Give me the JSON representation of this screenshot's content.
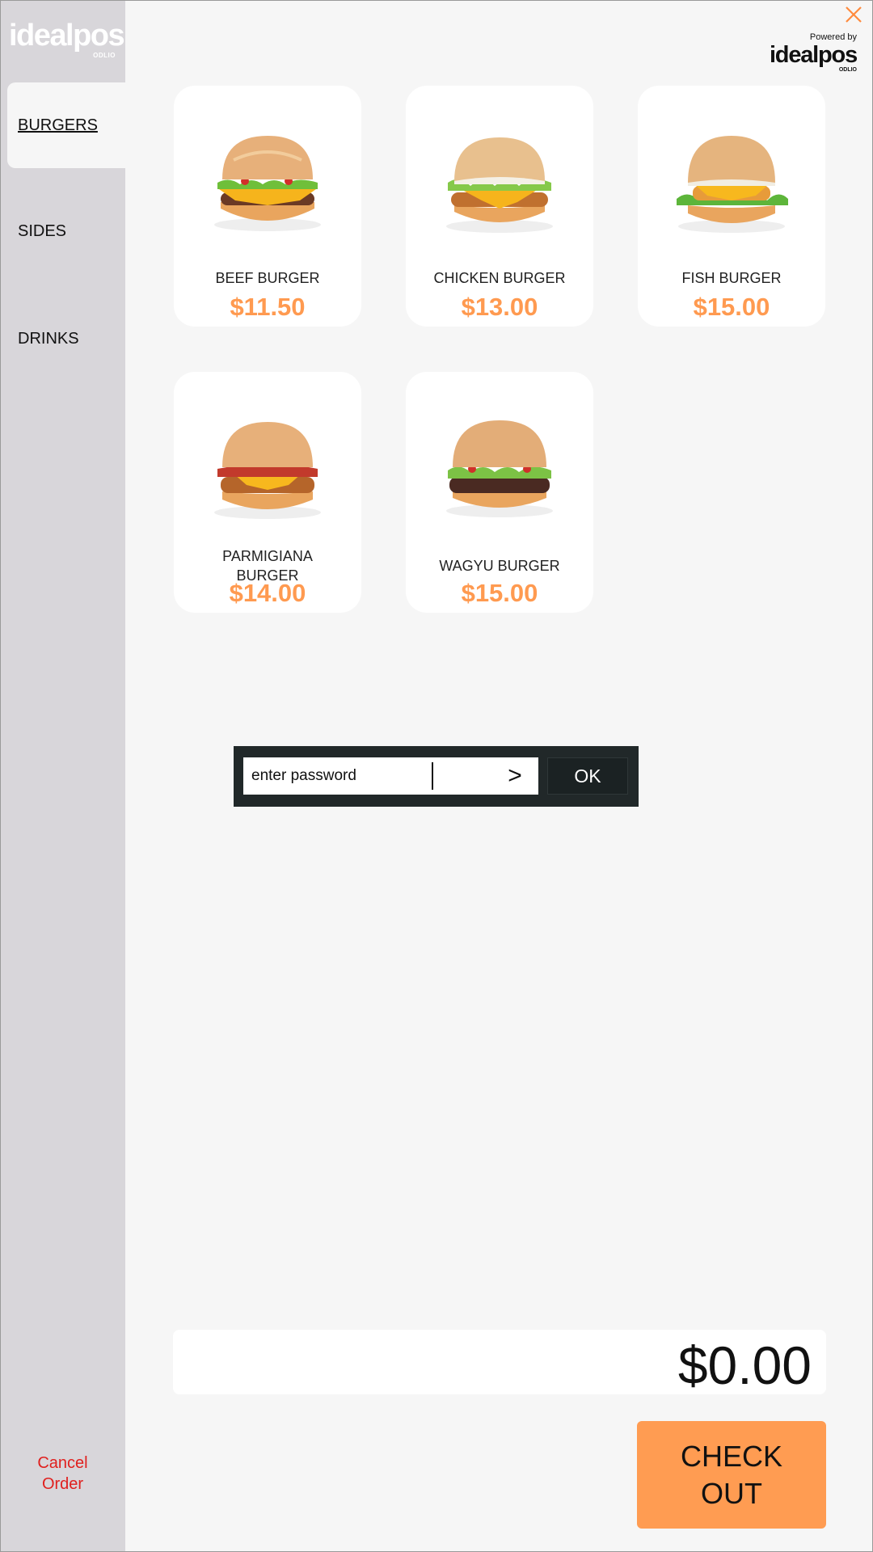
{
  "brand": {
    "name": "idealpos",
    "sub": "ODLIO"
  },
  "powered_by": {
    "label": "Powered by",
    "name": "idealpos",
    "sub": "ODLIO"
  },
  "sidebar": {
    "categories": [
      {
        "label": "BURGERS",
        "active": true
      },
      {
        "label": "SIDES",
        "active": false
      },
      {
        "label": "DRINKS",
        "active": false
      }
    ],
    "cancel_label": "Cancel\nOrder"
  },
  "products": [
    {
      "name": "BEEF BURGER",
      "price": "$11.50",
      "patty": "beef"
    },
    {
      "name": "CHICKEN BURGER",
      "price": "$13.00",
      "patty": "chicken"
    },
    {
      "name": "FISH BURGER",
      "price": "$15.00",
      "patty": "fish"
    },
    {
      "name": "PARMIGIANA BURGER",
      "price": "$14.00",
      "patty": "parmigiana"
    },
    {
      "name": "WAGYU BURGER",
      "price": "$15.00",
      "patty": "wagyu"
    }
  ],
  "password": {
    "placeholder": "enter password",
    "arrow": ">",
    "ok_label": "OK"
  },
  "total": {
    "value": "$0.00"
  },
  "checkout": {
    "label": "CHECK\nOUT"
  },
  "colors": {
    "accent": "#ff9a50",
    "sidebar": "#d8d6da",
    "cancel": "#e0201e",
    "dialog": "#212829"
  }
}
